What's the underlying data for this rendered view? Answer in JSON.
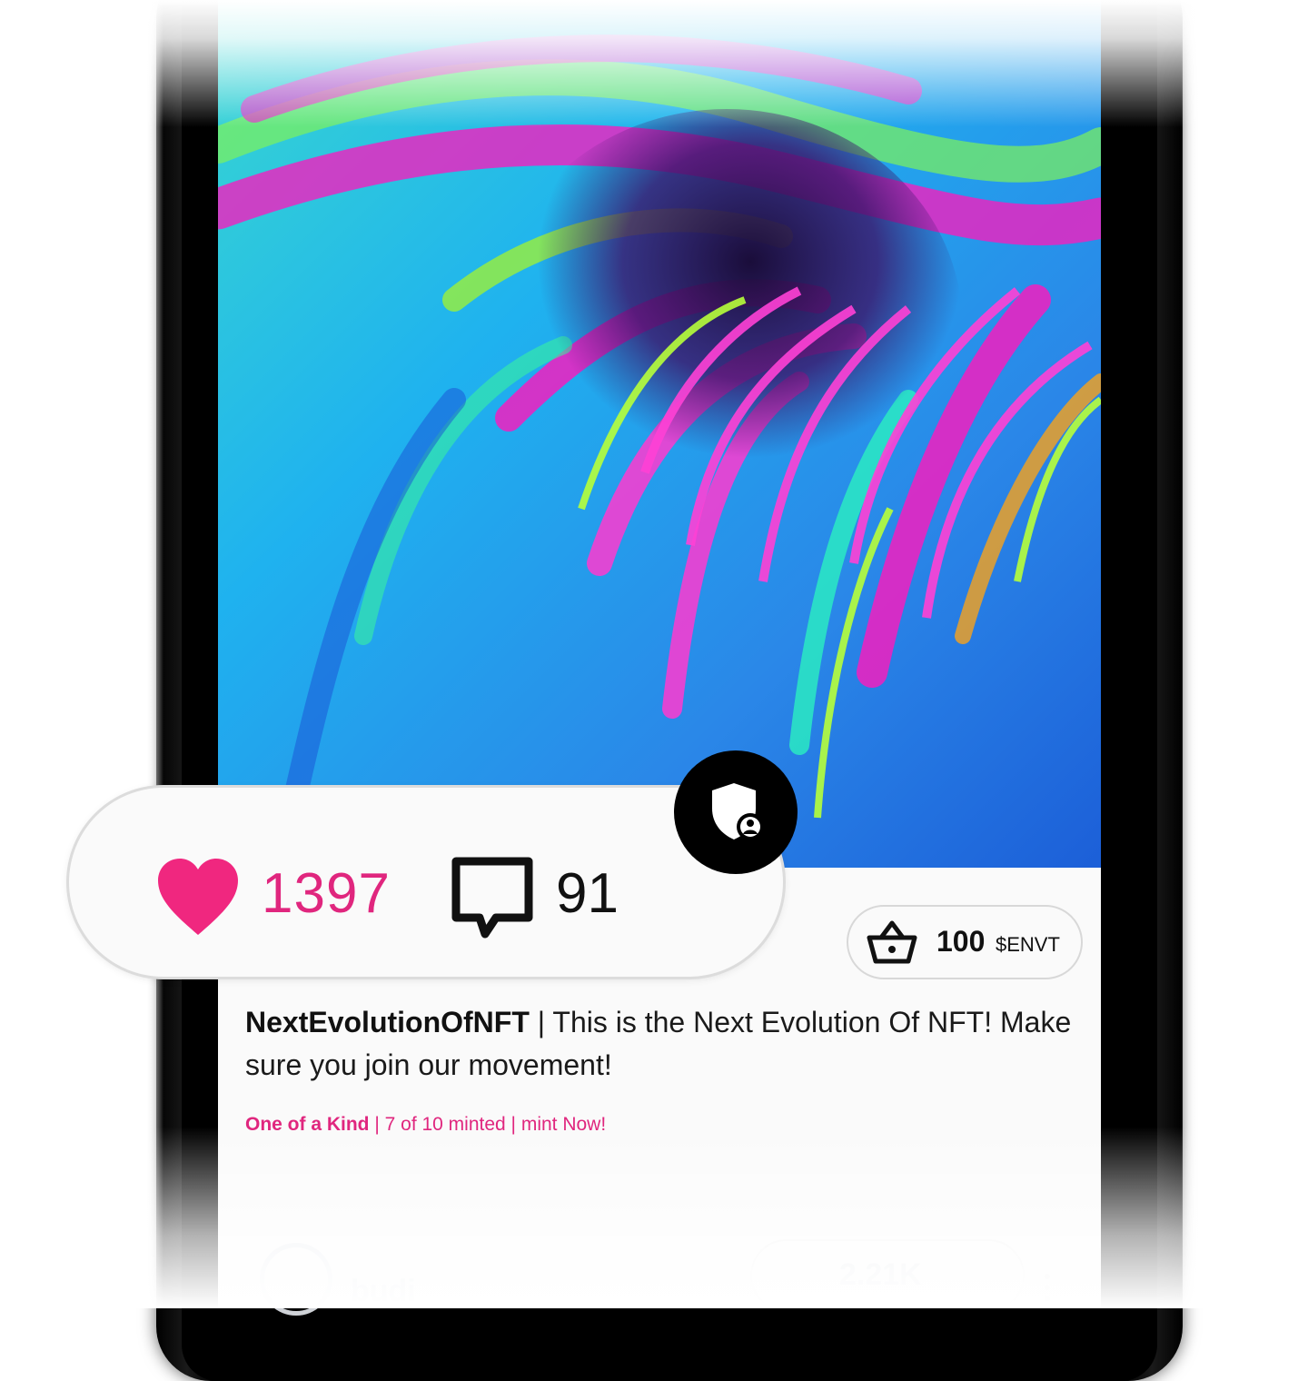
{
  "post": {
    "likes": "1397",
    "comments": "91",
    "price_value": "100",
    "price_unit": "$ENVT",
    "username": "NextEvolutionOfNFT",
    "separator": " | ",
    "caption_text": "This is the Next Evolution Of NFT! Make sure you join our movement!",
    "mint_kind": "One of a Kind",
    "mint_rest": " | 7 of 10 minted | mint Now!"
  },
  "next_post": {
    "username": "budi",
    "count": "2.21K"
  },
  "icons": {
    "like": "heart-icon",
    "comment": "comment-icon",
    "verify": "shield-user-icon",
    "basket": "basket-icon",
    "more": "more-vertical-icon"
  },
  "colors": {
    "accent": "#e0267e",
    "badge_bg": "#000000"
  }
}
